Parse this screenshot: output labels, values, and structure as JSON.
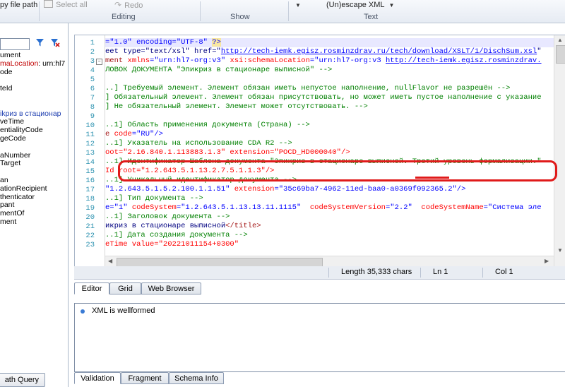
{
  "ribbon": {
    "copy_path": "py file path",
    "select_all": "Select all",
    "redo": "Redo",
    "unescape": "(Un)escape XML",
    "groups": {
      "editing": "Editing",
      "show": "Show",
      "text": "Text"
    }
  },
  "left": {
    "tree": [
      "ument",
      "maLocation: urn:hl7",
      "ode",
      "",
      "teId",
      "",
      "",
      "ikpиз в стационар",
      "veTime",
      "entialityCode",
      "geCode",
      "",
      "aNumber",
      "Target",
      "",
      "an",
      "ationRecipient",
      "thenticator",
      "pant",
      "mentOf",
      "ment"
    ],
    "xpath_button": "ath Query"
  },
  "editor": {
    "line_numbers": [
      "1",
      "2",
      "3",
      "4",
      "5",
      "6",
      "7",
      "8",
      "9",
      "10",
      "11",
      "12",
      "13",
      "14",
      "15",
      "16",
      "17",
      "18",
      "19",
      "20",
      "21",
      "22",
      "23"
    ],
    "lines": [
      [
        {
          "t": "=\"1.0\" encoding=\"UTF-8\" ",
          "c": "s"
        },
        {
          "t": "?>",
          "c": "s hl"
        }
      ],
      [
        {
          "t": "eet type=\"text/xsl\" href=\"",
          "c": "k"
        },
        {
          "t": "http://tech-iemk.egisz.rosminzdrav.ru/tech/download/XSLT/1/DischSum.xsl",
          "c": "u"
        },
        {
          "t": "\"",
          "c": "k"
        }
      ],
      [
        {
          "t": "ment ",
          "c": "t"
        },
        {
          "t": "xmlns",
          "c": "a"
        },
        {
          "t": "=\"urn:hl7-org:v3\" ",
          "c": "s"
        },
        {
          "t": "xsi:schemaLocation",
          "c": "a"
        },
        {
          "t": "=\"urn:hl7-org:v3 ",
          "c": "s"
        },
        {
          "t": "http://tech-iemk.egisz.rosminzdrav.",
          "c": "u"
        }
      ],
      [
        {
          "t": "ЛОВОК ДОКУМЕНТА \"Эпикриз в стационаре выписной\" -->",
          "c": "c"
        }
      ],
      [
        {
          "t": "",
          "c": "c"
        }
      ],
      [
        {
          "t": "..] Требуемый элемент. Элемент обязан иметь непустое наполнение, nullFlavor не разрешён -->",
          "c": "c"
        }
      ],
      [
        {
          "t": "] Обязательный элемент. Элемент обязан присутствовать, но может иметь пустое наполнение с указание",
          "c": "c"
        }
      ],
      [
        {
          "t": "] Не обязательный элемент. Элемент может отсутствовать. -->",
          "c": "c"
        }
      ],
      [
        {
          "t": "",
          "c": "c"
        }
      ],
      [
        {
          "t": "..1] Область применения документа (Страна) -->",
          "c": "c"
        }
      ],
      [
        {
          "t": "e ",
          "c": "t"
        },
        {
          "t": "code",
          "c": "a"
        },
        {
          "t": "=\"RU\"",
          "c": "s"
        },
        {
          "t": "/>",
          "c": "s"
        }
      ],
      [
        {
          "t": "..1] Указатель на использование CDA R2 -->",
          "c": "c"
        }
      ],
      [
        {
          "t": "oot=\"2.16.840.1.113883.1.3\" extension=\"POCD_HD000040\"/>",
          "c": "a"
        }
      ],
      [
        {
          "t": "..1] Идентификатор Шаблона документа \"Эпикриз в стационаре выписной. Третий уровень формализации.\"",
          "c": "c"
        }
      ],
      [
        {
          "t": "Id root=\"1.2.643.5.1.13.2.7.5.1.1.3\"/>",
          "c": "a"
        }
      ],
      [
        {
          "t": "..1] Уникальный идентификатор документа -->",
          "c": "c"
        }
      ],
      [
        {
          "t": "\"1.2.643.5.1.5.2.100.1.1.51\" ",
          "c": "s"
        },
        {
          "t": "extension",
          "c": "a"
        },
        {
          "t": "=\"35c69ba7-4962-11ed-baa0-a0369f092365.2\"",
          "c": "s"
        },
        {
          "t": "/>",
          "c": "s"
        }
      ],
      [
        {
          "t": "..1] Тип документа -->",
          "c": "c"
        }
      ],
      [
        {
          "t": "e=\"1\" ",
          "c": "s"
        },
        {
          "t": "codeSystem",
          "c": "a"
        },
        {
          "t": "=\"1.2.643.5.1.13.13.11.1115\"  ",
          "c": "s"
        },
        {
          "t": "codeSystemVersion",
          "c": "a"
        },
        {
          "t": "=\"2.2\"  ",
          "c": "s"
        },
        {
          "t": "codeSystemName",
          "c": "a"
        },
        {
          "t": "=\"Система эле",
          "c": "s"
        }
      ],
      [
        {
          "t": "..1] Заголовок документа -->",
          "c": "c"
        }
      ],
      [
        {
          "t": "икриз в стационаре выписной",
          "c": "k"
        },
        {
          "t": "</title>",
          "c": "t"
        }
      ],
      [
        {
          "t": "..1] Дата создания документа -->",
          "c": "c"
        }
      ],
      [
        {
          "t": "eTime value=\"20221011154+0300\"",
          "c": "a"
        }
      ]
    ]
  },
  "status": {
    "length": "Length 35,333 chars",
    "ln": "Ln 1",
    "col": "Col 1"
  },
  "bottom_tabs": [
    "Editor",
    "Grid",
    "Web Browser"
  ],
  "validation": {
    "message": "XML is wellformed"
  },
  "validation_tabs": [
    "Validation",
    "Fragment",
    "Schema Info"
  ]
}
